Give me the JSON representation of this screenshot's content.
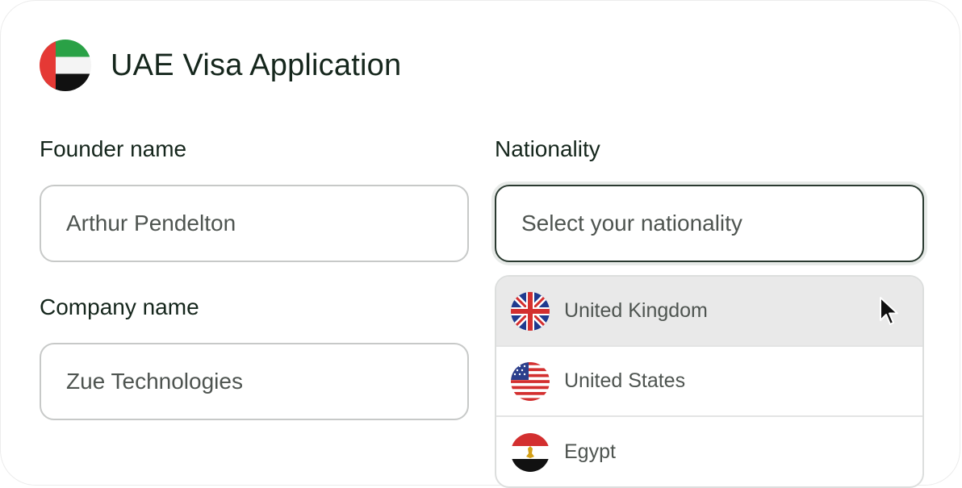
{
  "header": {
    "title": "UAE Visa Application",
    "flag_icon": "uae-flag-icon"
  },
  "form": {
    "founder_label": "Founder name",
    "founder_value": "Arthur Pendelton",
    "company_label": "Company name",
    "company_value": "Zue Technologies",
    "nationality_label": "Nationality",
    "nationality_placeholder": "Select your nationality"
  },
  "dropdown": {
    "options": [
      {
        "label": "United Kingdom",
        "icon": "uk-flag-icon",
        "hovered": true
      },
      {
        "label": "United States",
        "icon": "us-flag-icon",
        "hovered": false
      },
      {
        "label": "Egypt",
        "icon": "egypt-flag-icon",
        "hovered": false
      }
    ]
  },
  "colors": {
    "text_dark": "#15261c",
    "text_muted": "#4e5450",
    "select_border": "#2a3a30",
    "hover_bg": "#e9e9e9"
  }
}
